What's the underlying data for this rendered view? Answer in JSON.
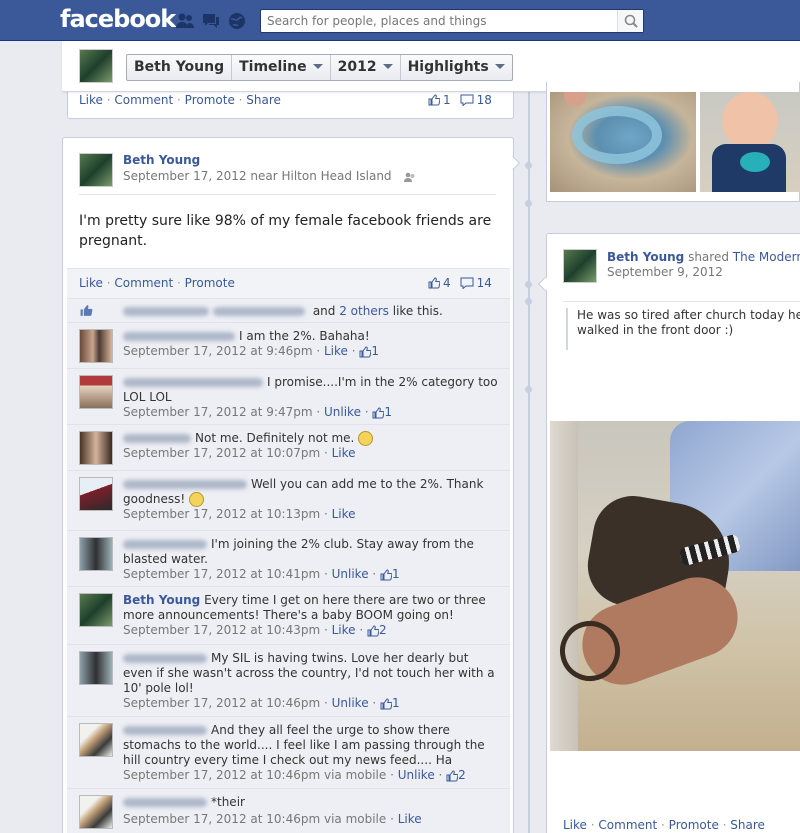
{
  "topbar": {
    "logo": "facebook",
    "search_placeholder": "Search for people, places and things",
    "jewels": [
      "friend-requests-icon",
      "messages-icon",
      "notifications-icon"
    ],
    "brand_color": "#3b5998"
  },
  "subnav": {
    "crumbs": [
      {
        "label": "Beth Young"
      },
      {
        "label": "Timeline"
      },
      {
        "label": "2012"
      },
      {
        "label": "Highlights"
      }
    ]
  },
  "top_post_bar": {
    "like": "Like",
    "comment": "Comment",
    "promote": "Promote",
    "share": "Share",
    "likes": "1",
    "comments": "18"
  },
  "post": {
    "author": "Beth Young",
    "meta": "September 17, 2012 near Hilton Head Island",
    "text": "I'm pretty sure like 98% of my female facebook friends are pregnant.",
    "actions": {
      "like": "Like",
      "comment": "Comment",
      "promote": "Promote"
    },
    "likes": "4",
    "comments": "14",
    "like_sentence": {
      "and": "and",
      "others": "2 others",
      "tail": "like this."
    },
    "comment_list": [
      {
        "text": "I am the 2%. Bahaha!",
        "time": "September 17, 2012 at 9:46pm",
        "action": "Like",
        "likes": "1"
      },
      {
        "text": "I promise....I'm in the 2% category too LOL LOL",
        "time": "September 17, 2012 at 9:47pm",
        "action": "Unlike",
        "likes": "1"
      },
      {
        "text": "Not me. Definitely not me.",
        "time": "September 17, 2012 at 10:07pm",
        "action": "Like",
        "likes": ""
      },
      {
        "text": "Well you can add me to the 2%. Thank goodness!",
        "time": "September 17, 2012 at 10:13pm",
        "action": "Like",
        "likes": ""
      },
      {
        "text": "I'm joining the 2% club. Stay away from the blasted water.",
        "time": "September 17, 2012 at 10:41pm",
        "action": "Unlike",
        "likes": "1"
      },
      {
        "author": "Beth Young",
        "text": "Every time I get on here there are two or three more announcements! There's a baby BOOM going on!",
        "time": "September 17, 2012 at 10:43pm",
        "action": "Like",
        "likes": "2"
      },
      {
        "text": "My SIL is having twins. Love her dearly but even if she wasn't across the country, I'd not touch her with a 10' pole lol!",
        "time": "September 17, 2012 at 10:46pm",
        "action": "Unlike",
        "likes": "1"
      },
      {
        "text": "And they all feel the urge to show there stomachs to the world.... I feel like I am passing through the hill country every time I check out my news feed.... Ha",
        "time": "September 17, 2012 at 10:46pm via mobile",
        "action": "Unlike",
        "likes": "2"
      },
      {
        "text": "*their",
        "time": "September 17, 2012 at 10:46pm via mobile",
        "action": "Like",
        "likes": ""
      }
    ]
  },
  "right_post": {
    "author": "Beth Young",
    "shared": "shared",
    "page": "The Modern",
    "date": "September 9, 2012",
    "quote": "He was so tired after church today he p walked in the front door :)",
    "actions": {
      "like": "Like",
      "comment": "Comment",
      "promote": "Promote",
      "share": "Share"
    }
  }
}
